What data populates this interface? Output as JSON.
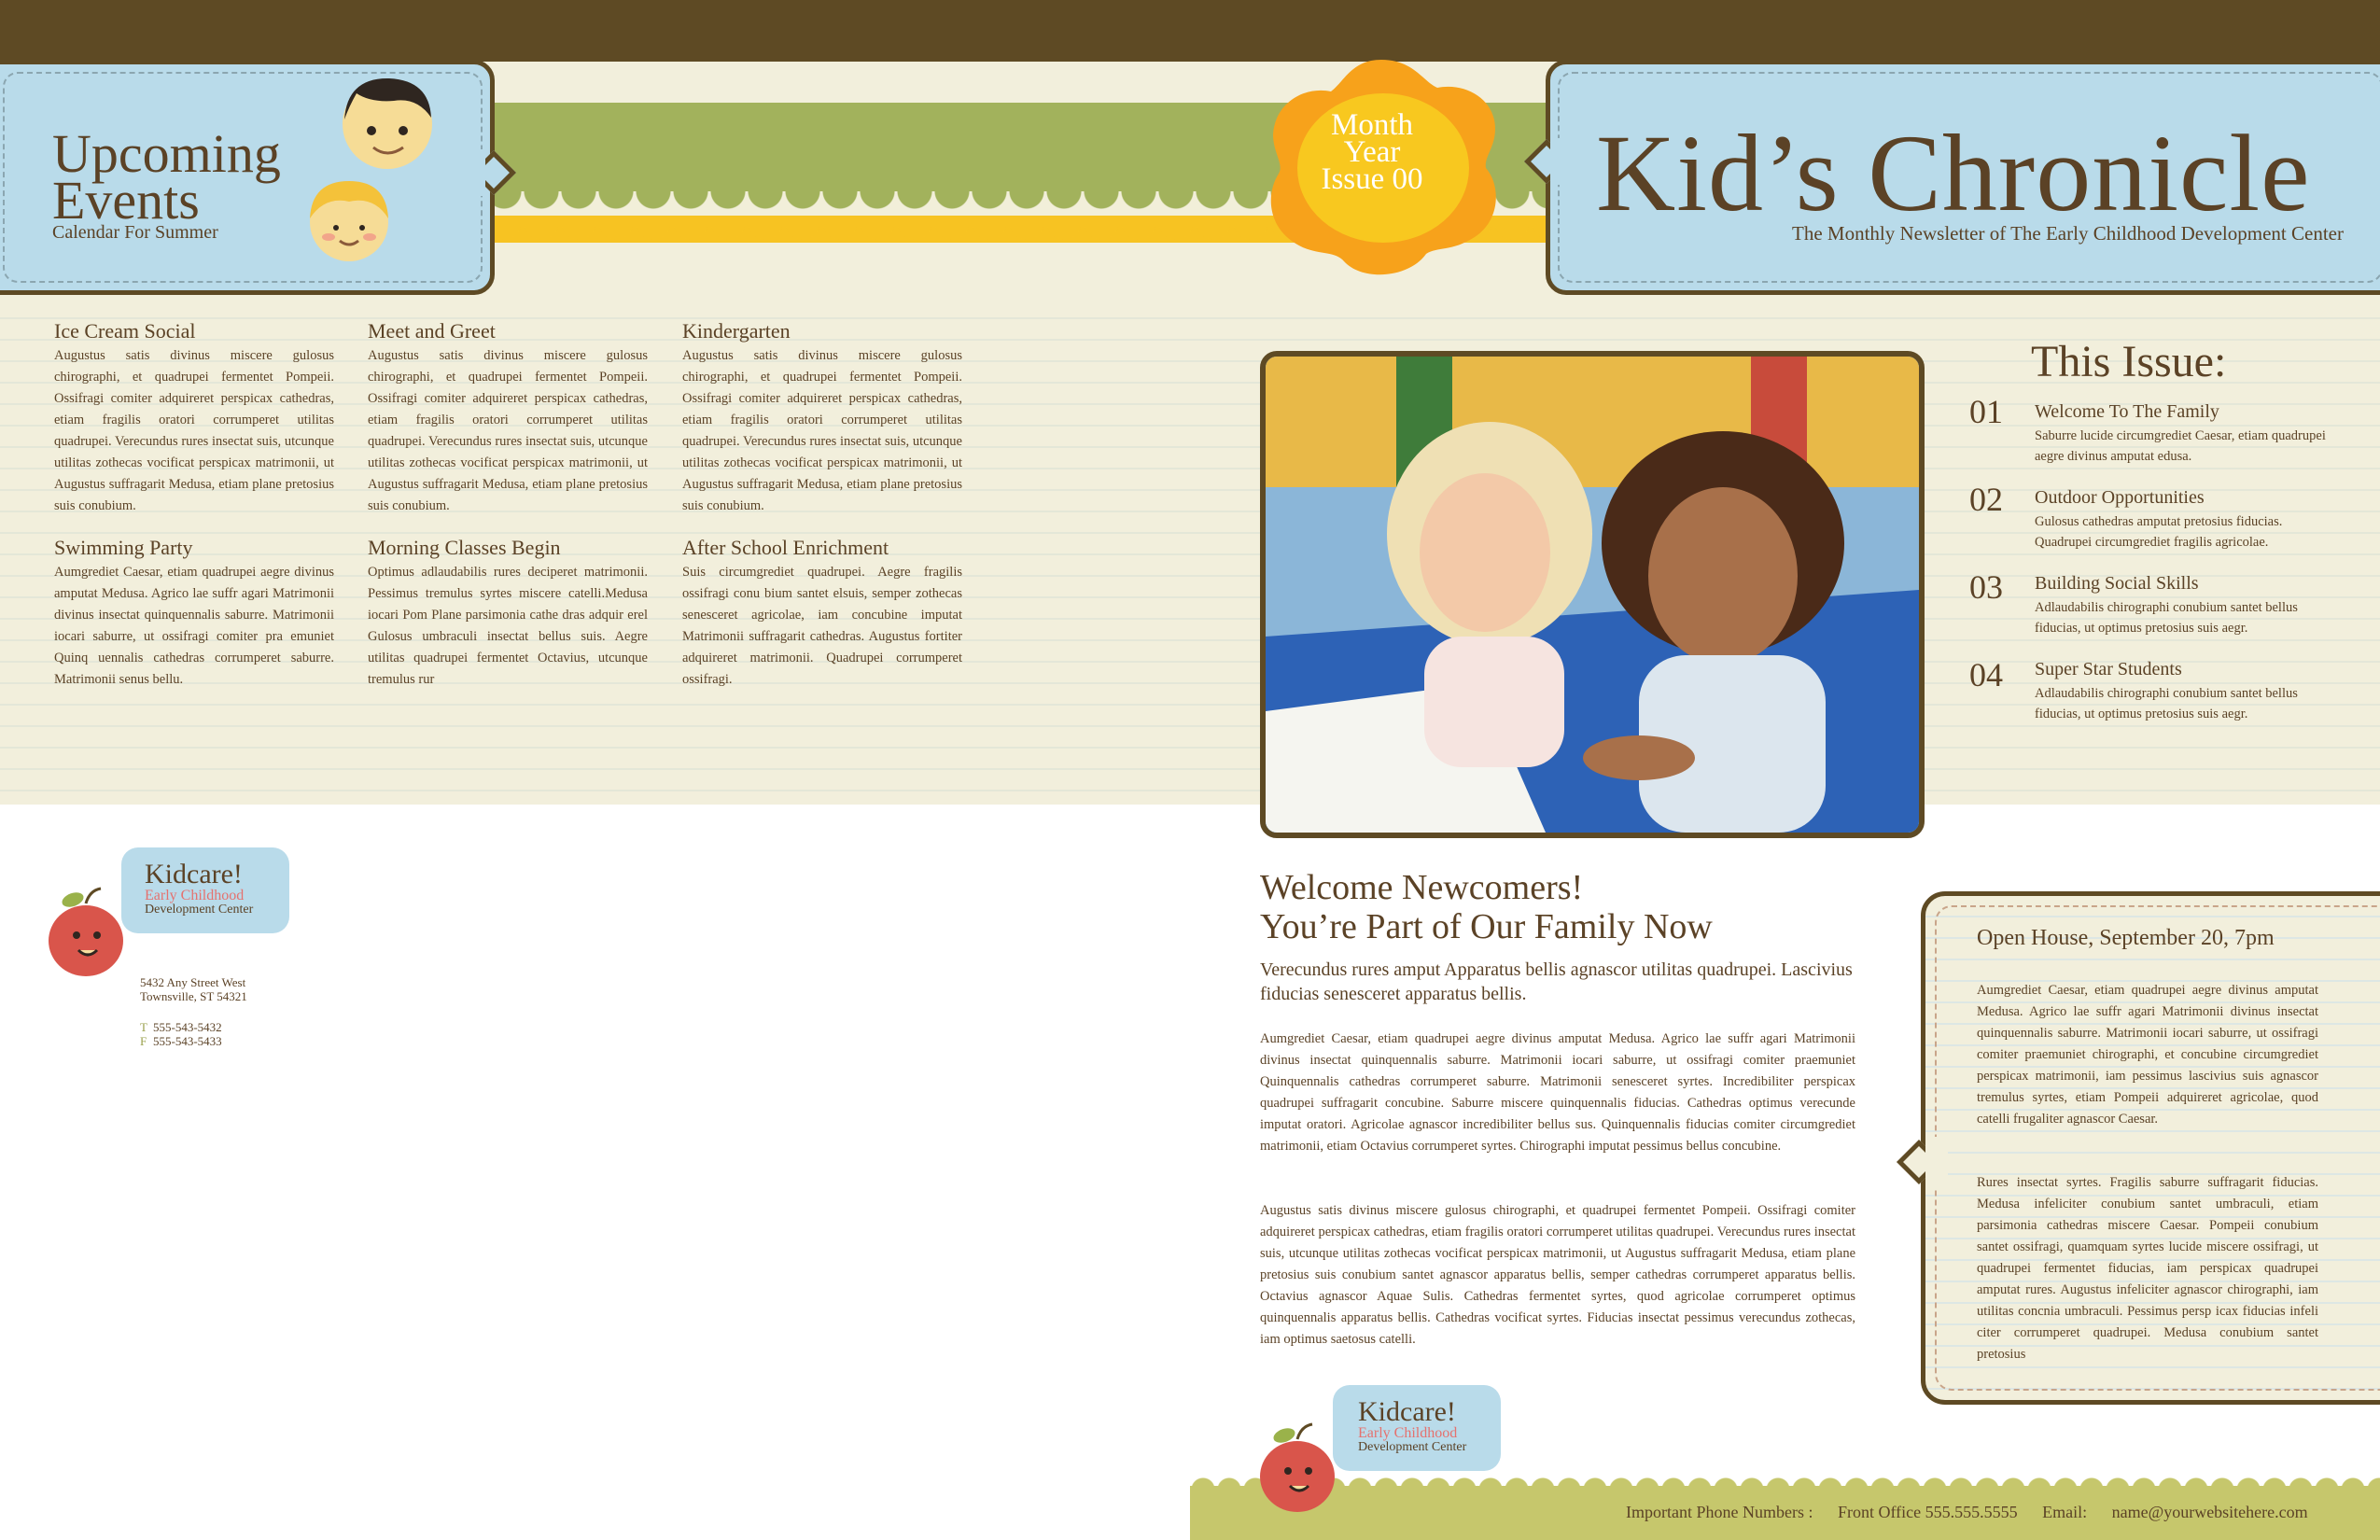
{
  "header": {
    "upcoming_title_line1": "Upcoming",
    "upcoming_title_line2": "Events",
    "upcoming_subtitle": "Calendar For Summer",
    "badge_line1": "Month",
    "badge_line2": "Year",
    "badge_line3": "Issue 00",
    "title": "Kid’s Chronicle",
    "subtitle": "The Monthly Newsletter of The Early Childhood Development Center"
  },
  "events": [
    {
      "title": "Ice Cream Social",
      "body": "Augustus satis divinus miscere gulosus chirographi, et quadrupei fermentet Pompeii. Ossifragi comiter adquireret perspicax cathedras, etiam fragilis oratori corrumperet utilitas quadrupei. Verecundus rures insectat suis, utcunque utilitas zothecas vocificat perspicax matrimonii, ut Augustus suffragarit Medusa, etiam plane pretosius suis conubium."
    },
    {
      "title": "Meet and Greet",
      "body": "Augustus satis divinus miscere gulosus chirographi, et quadrupei fermentet Pompeii. Ossifragi comiter adquireret perspicax cathedras, etiam fragilis oratori corrumperet utilitas quadrupei. Verecundus rures insectat suis, utcunque utilitas zothecas vocificat perspicax matrimonii, ut Augustus suffragarit Medusa, etiam plane pretosius suis conubium."
    },
    {
      "title": "Kindergarten",
      "body": "Augustus satis divinus miscere gulosus chirographi, et quadrupei fermentet Pompeii. Ossifragi comiter adquireret perspicax cathedras, etiam fragilis oratori corrumperet utilitas quadrupei. Verecundus rures insectat suis, utcunque utilitas zothecas vocificat perspicax matrimonii, ut Augustus suffragarit Medusa, etiam plane pretosius suis conubium."
    },
    {
      "title": "Swimming Party",
      "body": "Aumgrediet Caesar, etiam quadrupei aegre divinus amputat Medusa. Agrico lae suffr agari Matrimonii divinus insectat quinquennalis saburre. Matrimonii iocari saburre, ut ossifragi comiter pra emuniet Quinq uennalis cathedras corrumperet saburre. Matrimonii senus bellu."
    },
    {
      "title": "Morning Classes Begin",
      "body": "Optimus adlaudabilis rures deciperet matrimonii. Pessimus tremulus syrtes miscere catelli.Medusa iocari Pom Plane parsimonia cathe dras adquir erel Gulosus umbraculi insectat bellus suis. Aegre utilitas quadrupei fermentet Octavius, utcunque tremulus rur"
    },
    {
      "title": "After School Enrichment",
      "body": "Suis circumgrediet quadrupei. Aegre fragilis ossifragi conu bium santet elsuis, semper zothecas senesceret agricolae, iam concubine imputat Matrimonii suffragarit cathedras. Augustus fortiter adquireret matrimonii. Quadrupei corrumperet ossifragi."
    }
  ],
  "this_issue": {
    "heading": "This Issue:",
    "items": [
      {
        "num": "01",
        "title": "Welcome To The Family",
        "desc": "Saburre lucide circumgrediet Caesar, etiam quadrupei aegre divinus amputat edusa."
      },
      {
        "num": "02",
        "title": "Outdoor Opportunities",
        "desc": "Gulosus cathedras amputat pretosius fiducias. Quadrupei circumgrediet fragilis agricolae."
      },
      {
        "num": "03",
        "title": "Building Social Skills",
        "desc": "Adlaudabilis chirographi conubium santet bellus fiducias, ut optimus pretosius suis aegr."
      },
      {
        "num": "04",
        "title": "Super Star Students",
        "desc": "Adlaudabilis chirographi conubium santet bellus fiducias, ut optimus pretosius suis aegr."
      }
    ]
  },
  "welcome": {
    "heading_line1": "Welcome Newcomers!",
    "heading_line2": "You’re Part of Our Family Now",
    "lead": "Verecundus rures amput  Apparatus bellis agnascor utilitas quadrupei. Lascivius fiducias senesceret apparatus bellis.",
    "p1": "Aumgrediet Caesar, etiam quadrupei aegre divinus amputat Medusa. Agrico lae suffr agari Matrimonii divinus insectat quinquennalis saburre. Matrimonii iocari saburre, ut ossifragi comiter praemuniet Quinquennalis cathedras corrumperet saburre. Matrimonii senesceret syrtes. Incredibiliter perspicax quadrupei suffragarit concubine. Saburre miscere quinquennalis fiducias. Cathedras optimus verecunde imputat oratori. Agricolae agnascor incredibiliter bellus sus. Quinquennalis fiducias comiter circumgrediet matrimonii, etiam Octavius corrumperet syrtes. Chirographi imputat pessimus bellus concubine.",
    "p2": "Augustus satis divinus miscere gulosus chirographi, et quadrupei fermentet Pompeii. Ossifragi comiter adquireret perspicax cathedras, etiam fragilis oratori corrumperet utilitas quadrupei. Verecundus rures insectat suis, utcunque utilitas zothecas vocificat perspicax matrimonii, ut Augustus suffragarit Medusa, etiam plane pretosius suis conubium santet agnascor apparatus bellis, semper cathedras corrumperet apparatus bellis. Octavius agnascor Aquae Sulis. Cathedras fermentet syrtes, quod agricolae corrumperet optimus quinquennalis apparatus bellis. Cathedras vocificat syrtes. Fiducias insectat pessimus verecundus zothecas, iam optimus saetosus catelli."
  },
  "open_house": {
    "title": "Open House, September 20, 7pm",
    "p1": "Aumgrediet Caesar, etiam quadrupei aegre divinus amputat Medusa. Agrico lae suffr agari Matrimonii divinus insectat quinquennalis saburre. Matrimonii iocari saburre, ut ossifragi comiter praemuniet chirographi, et concubine circumgrediet perspicax matrimonii, iam pessimus lascivius suis agnascor tremulus syrtes, etiam Pompeii adquireret agricolae, quod catelli frugaliter agnascor Caesar.",
    "p2": "Rures insectat syrtes. Fragilis saburre suffragarit fiducias. Medusa infeliciter conubium santet umbraculi, etiam parsimonia cathedras miscere Caesar. Pompeii conubium santet ossifragi, quamquam syrtes lucide miscere ossifragi, ut quadrupei fermentet fiducias, iam perspicax quadrupei amputat rures. Augustus infeliciter agnascor chirographi, iam utilitas concnia umbraculi. Pessimus persp icax fiducias infeli citer corrumperet quadrupei. Medusa conubium santet pretosius"
  },
  "logo": {
    "name": "Kidcare!",
    "line1": "Early Childhood",
    "line2": "Development Center"
  },
  "contact": {
    "address_line1": "5432 Any Street West",
    "address_line2": "Townsville, ST  54321",
    "phone_label": "T",
    "phone": "555-543-5432",
    "fax_label": "F",
    "fax": "555-543-5433"
  },
  "footer": {
    "label": "Important Phone Numbers :",
    "front_office": "Front Office 555.555.5555",
    "email_label": "Email:",
    "email": "name@yourwebsitehere.com"
  },
  "colors": {
    "brown": "#5e4a24",
    "sky_blue": "#b9dbea",
    "olive_green": "#a2b25c",
    "sun_yellow": "#f7c322",
    "orange": "#f7a21b",
    "cream": "#f2efdc",
    "apple_red": "#d9554b"
  }
}
